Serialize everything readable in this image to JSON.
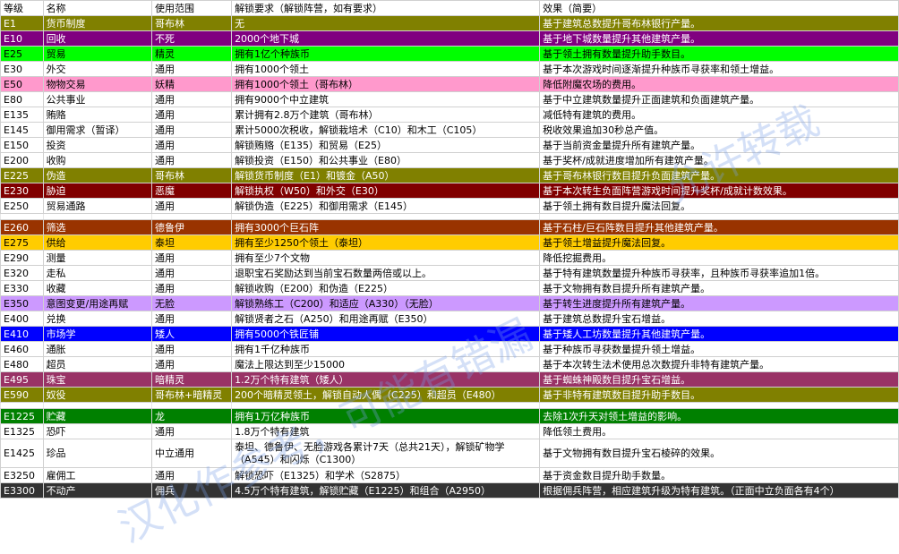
{
  "header": [
    "等级",
    "名称",
    "使用范围",
    "解锁要求（解锁阵营，如有要求）",
    "效果（简要）"
  ],
  "rows": [
    {
      "code": "E1",
      "name": "货币制度",
      "scope": "哥布林",
      "req": "无",
      "effect": "基于建筑总数提升哥布林银行产量。",
      "bg": "#808000",
      "fg": "#ffffff"
    },
    {
      "code": "E10",
      "name": "回收",
      "scope": "不死",
      "req": "2000个地下城",
      "effect": "基于地下城数量提升其他建筑产量。",
      "bg": "#800080",
      "fg": "#ffffff"
    },
    {
      "code": "E25",
      "name": "贸易",
      "scope": "精灵",
      "req": "拥有1亿个种族币",
      "effect": "基于领土拥有数量提升助手数目。",
      "bg": "#00ff00",
      "fg": "#000000"
    },
    {
      "code": "E30",
      "name": "外交",
      "scope": "通用",
      "req": "拥有1000个领土",
      "effect": "基于本次游戏时间逐渐提升种族币寻获率和领土增益。",
      "bg": "#ffffff",
      "fg": "#000000"
    },
    {
      "code": "E50",
      "name": "物物交易",
      "scope": "妖精",
      "req": "拥有1000个领土（哥布林）",
      "effect": "降低附魔农场的费用。",
      "bg": "#ff99cc",
      "fg": "#000000"
    },
    {
      "code": "E80",
      "name": "公共事业",
      "scope": "通用",
      "req": "拥有9000个中立建筑",
      "effect": "基于中立建筑数量提升正面建筑和负面建筑产量。",
      "bg": "#ffffff",
      "fg": "#000000"
    },
    {
      "code": "E135",
      "name": "贿赂",
      "scope": "通用",
      "req": "累计拥有2.8万个建筑（哥布林）",
      "effect": "减低特有建筑的费用。",
      "bg": "#ffffff",
      "fg": "#000000"
    },
    {
      "code": "E145",
      "name": "御用需求（暂译）",
      "scope": "通用",
      "req": "累计5000次税收，解锁栽培术（C10）和木工（C105）",
      "effect": "税收效果追加30秒总产值。",
      "bg": "#ffffff",
      "fg": "#000000"
    },
    {
      "code": "E150",
      "name": "投资",
      "scope": "通用",
      "req": "解锁贿赂（E135）和贸易（E25）",
      "effect": "基于当前资金量提升所有建筑产量。",
      "bg": "#ffffff",
      "fg": "#000000"
    },
    {
      "code": "E200",
      "name": "收购",
      "scope": "通用",
      "req": "解锁投资（E150）和公共事业（E80）",
      "effect": "基于奖杯/成就进度增加所有建筑产量。",
      "bg": "#ffffff",
      "fg": "#000000"
    },
    {
      "code": "E225",
      "name": "伪造",
      "scope": "哥布林",
      "req": "解锁货币制度（E1）和镀金（A50）",
      "effect": "基于哥布林银行数目提升负面建筑产量。",
      "bg": "#808000",
      "fg": "#ffffff"
    },
    {
      "code": "E230",
      "name": "胁迫",
      "scope": "恶魔",
      "req": "解锁执权（W50）和外交（E30）",
      "effect": "基于本次转生负面阵营游戏时间提升奖杯/成就计数效果。",
      "bg": "#800000",
      "fg": "#ffffff"
    },
    {
      "code": "E250",
      "name": "贸易通路",
      "scope": "通用",
      "req": "解锁伪造（E225）和御用需求（E145）",
      "effect": "基于领土拥有数目提升魔法回复。",
      "bg": "#ffffff",
      "fg": "#000000"
    },
    {
      "blank": true
    },
    {
      "code": "E260",
      "name": "筛选",
      "scope": "德鲁伊",
      "req": "拥有3000个巨石阵",
      "effect": "基于石柱/巨石阵数目提升其他建筑产量。",
      "bg": "#993300",
      "fg": "#ffffff"
    },
    {
      "code": "E275",
      "name": "供给",
      "scope": "泰坦",
      "req": "拥有至少1250个领土（泰坦）",
      "effect": "基于领土增益提升魔法回复。",
      "bg": "#ffcc00",
      "fg": "#000000"
    },
    {
      "code": "E290",
      "name": "测量",
      "scope": "通用",
      "req": "拥有至少7个文物",
      "effect": "降低挖掘费用。",
      "bg": "#ffffff",
      "fg": "#000000"
    },
    {
      "code": "E320",
      "name": "走私",
      "scope": "通用",
      "req": "退职宝石奖励达到当前宝石数量两倍或以上。",
      "effect": "基于特有建筑数量提升种族币寻获率，且种族币寻获率追加1倍。",
      "bg": "#ffffff",
      "fg": "#000000"
    },
    {
      "code": "E330",
      "name": "收藏",
      "scope": "通用",
      "req": "解锁收购（E200）和伪造（E225）",
      "effect": "基于文物拥有数目提升所有建筑产量。",
      "bg": "#ffffff",
      "fg": "#000000"
    },
    {
      "code": "E350",
      "name": "意图变更/用途再赋",
      "scope": "无脸",
      "req": "解锁熟练工（C200）和适应（A330）（无脸）",
      "effect": "基于转生进度提升所有建筑产量。",
      "bg": "#cc99ff",
      "fg": "#000000"
    },
    {
      "code": "E400",
      "name": "兑换",
      "scope": "通用",
      "req": "解锁贤者之石（A250）和用途再赋（E350）",
      "effect": "基于建筑总数提升宝石增益。",
      "bg": "#ffffff",
      "fg": "#000000"
    },
    {
      "code": "E410",
      "name": "市场学",
      "scope": "矮人",
      "req": "拥有5000个铁匠铺",
      "effect": "基于矮人工坊数量提升其他建筑产量。",
      "bg": "#0000ff",
      "fg": "#ffffff"
    },
    {
      "code": "E460",
      "name": "通胀",
      "scope": "通用",
      "req": "拥有1千亿种族币",
      "effect": "基于种族币寻获数量提升领土增益。",
      "bg": "#ffffff",
      "fg": "#000000"
    },
    {
      "code": "E480",
      "name": "超员",
      "scope": "通用",
      "req": "魔法上限达到至少15000",
      "effect": "基于本次转生法术使用总次数提升非特有建筑产量。",
      "bg": "#ffffff",
      "fg": "#000000"
    },
    {
      "code": "E495",
      "name": "珠宝",
      "scope": "暗精灵",
      "req": "1.2万个特有建筑（矮人）",
      "effect": "基于蜘蛛神殿数目提升宝石增益。",
      "bg": "#993366",
      "fg": "#ffffff"
    },
    {
      "code": "E590",
      "name": "奴役",
      "scope": "哥布林+暗精灵",
      "req": "200个暗精灵领土，解锁自动人偶（C225）和超员（E480）",
      "effect": "基于非特有建筑数目提升助手数目。",
      "bg": "#808000",
      "fg": "#ffffff"
    },
    {
      "blank": true
    },
    {
      "code": "E1225",
      "name": "贮藏",
      "scope": "龙",
      "req": "拥有1万亿种族币",
      "effect": "去除1次升天对领土增益的影响。",
      "bg": "#008000",
      "fg": "#ffffff"
    },
    {
      "code": "E1325",
      "name": "恐吓",
      "scope": "通用",
      "req": "1.8万个特有建筑",
      "effect": "降低领土费用。",
      "bg": "#ffffff",
      "fg": "#000000"
    },
    {
      "code": "E1425",
      "name": "珍品",
      "scope": "中立通用",
      "req": "泰坦、德鲁伊、无脸游戏各累计7天（总共21天），解锁矿物学（A545）和闪烁（C1300）",
      "effect": "基于文物拥有数目提升宝石棱碎的效果。",
      "bg": "#ffffff",
      "fg": "#000000",
      "tall": true
    },
    {
      "code": "E3250",
      "name": "雇佣工",
      "scope": "通用",
      "req": "解锁恐吓（E1325）和学术（S2875）",
      "effect": "基于资金数目提升助手数量。",
      "bg": "#ffffff",
      "fg": "#000000"
    },
    {
      "code": "E3300",
      "name": "不动产",
      "scope": "佣兵",
      "req": "4.5万个特有建筑，解锁贮藏（E1225）和组合（A2950）",
      "effect": "根据佣兵阵营，相应建筑升级为特有建筑。（正面中立负面各有4个）",
      "bg": "#333333",
      "fg": "#ffffff"
    }
  ],
  "watermark": [
    "汉化作参考，可能有错漏",
    "允许转载"
  ]
}
